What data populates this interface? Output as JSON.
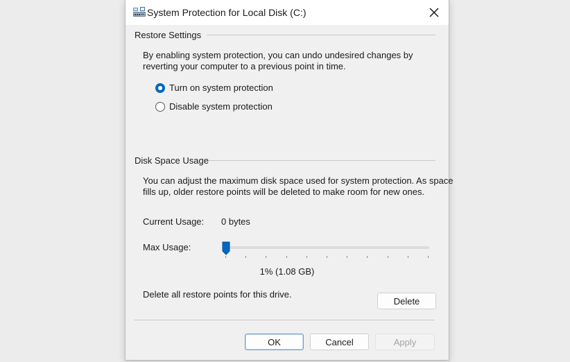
{
  "window": {
    "title": "System Protection for Local Disk (C:)",
    "app_icon": "system-protection-icon",
    "close_icon": "close-icon"
  },
  "restore_settings": {
    "group_label": "Restore Settings",
    "description_line1": "By enabling system protection, you can undo undesired changes by",
    "description_line2": "reverting your computer to a previous point in time.",
    "options": [
      {
        "label": "Turn on system protection",
        "selected": true
      },
      {
        "label": "Disable system protection",
        "selected": false
      }
    ]
  },
  "disk_space": {
    "group_label": "Disk Space Usage",
    "description_line1": "You can adjust the maximum disk space used for system protection. As space",
    "description_line2": "fills up, older restore points will be deleted to make room for new ones.",
    "current_usage_label": "Current Usage:",
    "current_usage_value": "0 bytes",
    "max_usage_label": "Max Usage:",
    "max_usage_percent": 1,
    "max_usage_display": "1% (1.08 GB)",
    "delete_text": "Delete all restore points for this drive.",
    "delete_button": "Delete"
  },
  "footer": {
    "ok": "OK",
    "cancel": "Cancel",
    "apply": "Apply",
    "apply_enabled": false
  },
  "colors": {
    "accent": "#0067c0",
    "dialog_background": "#f0f0f0",
    "page_background": "#ececec"
  }
}
